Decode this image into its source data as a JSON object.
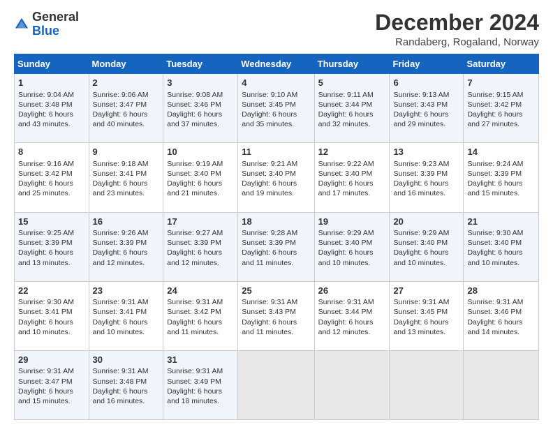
{
  "header": {
    "logo": {
      "general": "General",
      "blue": "Blue"
    },
    "title": "December 2024",
    "location": "Randaberg, Rogaland, Norway"
  },
  "columns": [
    "Sunday",
    "Monday",
    "Tuesday",
    "Wednesday",
    "Thursday",
    "Friday",
    "Saturday"
  ],
  "weeks": [
    [
      {
        "day": "1",
        "sunrise": "Sunrise: 9:04 AM",
        "sunset": "Sunset: 3:48 PM",
        "daylight": "Daylight: 6 hours and 43 minutes."
      },
      {
        "day": "2",
        "sunrise": "Sunrise: 9:06 AM",
        "sunset": "Sunset: 3:47 PM",
        "daylight": "Daylight: 6 hours and 40 minutes."
      },
      {
        "day": "3",
        "sunrise": "Sunrise: 9:08 AM",
        "sunset": "Sunset: 3:46 PM",
        "daylight": "Daylight: 6 hours and 37 minutes."
      },
      {
        "day": "4",
        "sunrise": "Sunrise: 9:10 AM",
        "sunset": "Sunset: 3:45 PM",
        "daylight": "Daylight: 6 hours and 35 minutes."
      },
      {
        "day": "5",
        "sunrise": "Sunrise: 9:11 AM",
        "sunset": "Sunset: 3:44 PM",
        "daylight": "Daylight: 6 hours and 32 minutes."
      },
      {
        "day": "6",
        "sunrise": "Sunrise: 9:13 AM",
        "sunset": "Sunset: 3:43 PM",
        "daylight": "Daylight: 6 hours and 29 minutes."
      },
      {
        "day": "7",
        "sunrise": "Sunrise: 9:15 AM",
        "sunset": "Sunset: 3:42 PM",
        "daylight": "Daylight: 6 hours and 27 minutes."
      }
    ],
    [
      {
        "day": "8",
        "sunrise": "Sunrise: 9:16 AM",
        "sunset": "Sunset: 3:42 PM",
        "daylight": "Daylight: 6 hours and 25 minutes."
      },
      {
        "day": "9",
        "sunrise": "Sunrise: 9:18 AM",
        "sunset": "Sunset: 3:41 PM",
        "daylight": "Daylight: 6 hours and 23 minutes."
      },
      {
        "day": "10",
        "sunrise": "Sunrise: 9:19 AM",
        "sunset": "Sunset: 3:40 PM",
        "daylight": "Daylight: 6 hours and 21 minutes."
      },
      {
        "day": "11",
        "sunrise": "Sunrise: 9:21 AM",
        "sunset": "Sunset: 3:40 PM",
        "daylight": "Daylight: 6 hours and 19 minutes."
      },
      {
        "day": "12",
        "sunrise": "Sunrise: 9:22 AM",
        "sunset": "Sunset: 3:40 PM",
        "daylight": "Daylight: 6 hours and 17 minutes."
      },
      {
        "day": "13",
        "sunrise": "Sunrise: 9:23 AM",
        "sunset": "Sunset: 3:39 PM",
        "daylight": "Daylight: 6 hours and 16 minutes."
      },
      {
        "day": "14",
        "sunrise": "Sunrise: 9:24 AM",
        "sunset": "Sunset: 3:39 PM",
        "daylight": "Daylight: 6 hours and 15 minutes."
      }
    ],
    [
      {
        "day": "15",
        "sunrise": "Sunrise: 9:25 AM",
        "sunset": "Sunset: 3:39 PM",
        "daylight": "Daylight: 6 hours and 13 minutes."
      },
      {
        "day": "16",
        "sunrise": "Sunrise: 9:26 AM",
        "sunset": "Sunset: 3:39 PM",
        "daylight": "Daylight: 6 hours and 12 minutes."
      },
      {
        "day": "17",
        "sunrise": "Sunrise: 9:27 AM",
        "sunset": "Sunset: 3:39 PM",
        "daylight": "Daylight: 6 hours and 12 minutes."
      },
      {
        "day": "18",
        "sunrise": "Sunrise: 9:28 AM",
        "sunset": "Sunset: 3:39 PM",
        "daylight": "Daylight: 6 hours and 11 minutes."
      },
      {
        "day": "19",
        "sunrise": "Sunrise: 9:29 AM",
        "sunset": "Sunset: 3:40 PM",
        "daylight": "Daylight: 6 hours and 10 minutes."
      },
      {
        "day": "20",
        "sunrise": "Sunrise: 9:29 AM",
        "sunset": "Sunset: 3:40 PM",
        "daylight": "Daylight: 6 hours and 10 minutes."
      },
      {
        "day": "21",
        "sunrise": "Sunrise: 9:30 AM",
        "sunset": "Sunset: 3:40 PM",
        "daylight": "Daylight: 6 hours and 10 minutes."
      }
    ],
    [
      {
        "day": "22",
        "sunrise": "Sunrise: 9:30 AM",
        "sunset": "Sunset: 3:41 PM",
        "daylight": "Daylight: 6 hours and 10 minutes."
      },
      {
        "day": "23",
        "sunrise": "Sunrise: 9:31 AM",
        "sunset": "Sunset: 3:41 PM",
        "daylight": "Daylight: 6 hours and 10 minutes."
      },
      {
        "day": "24",
        "sunrise": "Sunrise: 9:31 AM",
        "sunset": "Sunset: 3:42 PM",
        "daylight": "Daylight: 6 hours and 11 minutes."
      },
      {
        "day": "25",
        "sunrise": "Sunrise: 9:31 AM",
        "sunset": "Sunset: 3:43 PM",
        "daylight": "Daylight: 6 hours and 11 minutes."
      },
      {
        "day": "26",
        "sunrise": "Sunrise: 9:31 AM",
        "sunset": "Sunset: 3:44 PM",
        "daylight": "Daylight: 6 hours and 12 minutes."
      },
      {
        "day": "27",
        "sunrise": "Sunrise: 9:31 AM",
        "sunset": "Sunset: 3:45 PM",
        "daylight": "Daylight: 6 hours and 13 minutes."
      },
      {
        "day": "28",
        "sunrise": "Sunrise: 9:31 AM",
        "sunset": "Sunset: 3:46 PM",
        "daylight": "Daylight: 6 hours and 14 minutes."
      }
    ],
    [
      {
        "day": "29",
        "sunrise": "Sunrise: 9:31 AM",
        "sunset": "Sunset: 3:47 PM",
        "daylight": "Daylight: 6 hours and 15 minutes."
      },
      {
        "day": "30",
        "sunrise": "Sunrise: 9:31 AM",
        "sunset": "Sunset: 3:48 PM",
        "daylight": "Daylight: 6 hours and 16 minutes."
      },
      {
        "day": "31",
        "sunrise": "Sunrise: 9:31 AM",
        "sunset": "Sunset: 3:49 PM",
        "daylight": "Daylight: 6 hours and 18 minutes."
      },
      null,
      null,
      null,
      null
    ]
  ]
}
